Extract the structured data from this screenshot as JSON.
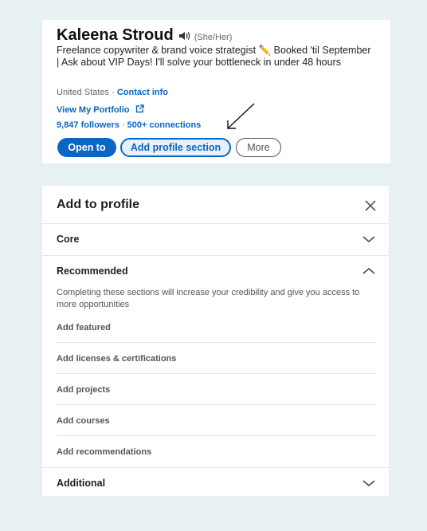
{
  "profile": {
    "name": "Kaleena Stroud",
    "pronouns": "(She/Her)",
    "headline": "Freelance copywriter & brand voice strategist ✏️ Booked 'til September | Ask about VIP Days! I'll solve your bottleneck in under 48 hours",
    "location": "United States",
    "location_sep": " · ",
    "contact_link": "Contact info",
    "portfolio_link": "View My Portfolio",
    "followers": "9,847 followers",
    "followers_sep": " · ",
    "connections": "500+ connections"
  },
  "actions": {
    "open_to": "Open to",
    "add_section": "Add profile section",
    "more": "More"
  },
  "panel": {
    "title": "Add to profile",
    "sections": {
      "core": "Core",
      "recommended": "Recommended",
      "recommended_desc": "Completing these sections will increase your credibility and give you access to more opportunities",
      "additional": "Additional"
    },
    "recommended_items": [
      "Add featured",
      "Add licenses & certifications",
      "Add projects",
      "Add courses",
      "Add recommendations"
    ]
  },
  "colors": {
    "brand": "#0a66c2",
    "background": "#e8f1f1"
  },
  "icons": [
    "speaker-icon",
    "external-link-icon",
    "arrow-annotation",
    "close-icon",
    "chevron-down-icon",
    "chevron-up-icon"
  ]
}
